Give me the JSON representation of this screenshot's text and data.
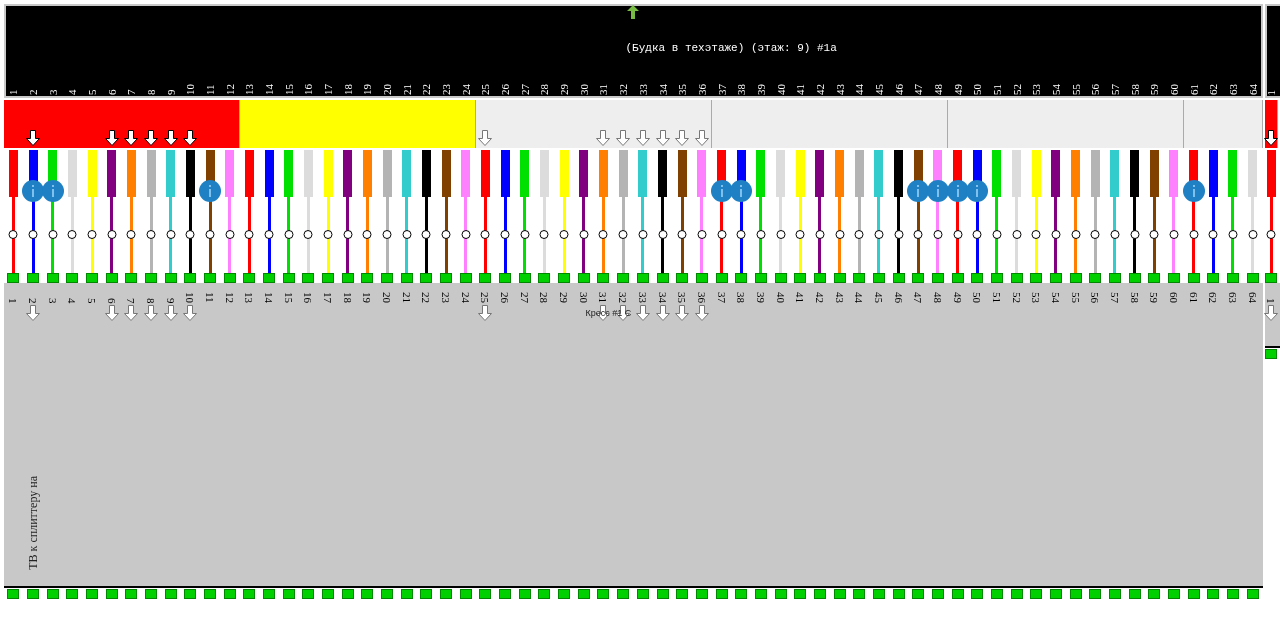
{
  "module": {
    "title": "(Будка в техэтаже) (этаж: 9) #1a",
    "caption": "Кросс #1 С",
    "side_text": "ТВ к сплиттеру на",
    "tubes": [
      {
        "color": "#ff0000",
        "fibers": [
          {
            "top_number": "1",
            "color": "#ff0000",
            "info": false,
            "bottom_number": "1",
            "bottom_arrow": false
          },
          {
            "top_number": "2",
            "color": "#0000ff",
            "band_arrow": {
              "kind": "solid"
            },
            "info": true,
            "bottom_number": "2",
            "bottom_arrow": true
          },
          {
            "top_number": "3",
            "color": "#00e000",
            "info": true,
            "bottom_number": "3",
            "bottom_arrow": false
          },
          {
            "top_number": "4",
            "color": "#dcdcdc",
            "info": false,
            "bottom_number": "4",
            "bottom_arrow": false
          },
          {
            "top_number": "5",
            "color": "#ffff00",
            "info": false,
            "bottom_number": "5",
            "bottom_arrow": false
          },
          {
            "top_number": "6",
            "color": "#800080",
            "band_arrow": {
              "kind": "solid"
            },
            "info": false,
            "bottom_number": "6",
            "bottom_arrow": true
          },
          {
            "top_number": "7",
            "color": "#ff8000",
            "band_arrow": {
              "kind": "solid"
            },
            "info": false,
            "bottom_number": "7",
            "bottom_arrow": true
          },
          {
            "top_number": "8",
            "color": "#b4b4b4",
            "band_arrow": {
              "kind": "solid"
            },
            "info": false,
            "bottom_number": "8",
            "bottom_arrow": true
          },
          {
            "top_number": "9",
            "color": "#33cccc",
            "band_arrow": {
              "kind": "solid"
            },
            "info": false,
            "bottom_number": "9",
            "bottom_arrow": true
          },
          {
            "top_number": "10",
            "color": "#000000",
            "band_arrow": {
              "kind": "solid"
            },
            "info": false,
            "bottom_number": "10",
            "bottom_arrow": true
          },
          {
            "top_number": "11",
            "color": "#804000",
            "info": true,
            "bottom_number": "11",
            "bottom_arrow": false
          },
          {
            "top_number": "12",
            "color": "#ff80ff",
            "info": false,
            "bottom_number": "12",
            "bottom_arrow": false
          }
        ]
      },
      {
        "color": "#ffff00",
        "fibers": [
          {
            "top_number": "13",
            "color": "#ff0000",
            "info": false,
            "bottom_number": "13",
            "bottom_arrow": false
          },
          {
            "top_number": "14",
            "color": "#0000ff",
            "info": false,
            "bottom_number": "14",
            "bottom_arrow": false
          },
          {
            "top_number": "15",
            "color": "#00e000",
            "info": false,
            "bottom_number": "15",
            "bottom_arrow": false
          },
          {
            "top_number": "16",
            "color": "#dcdcdc",
            "info": false,
            "bottom_number": "16",
            "bottom_arrow": false
          },
          {
            "top_number": "17",
            "color": "#ffff00",
            "info": false,
            "bottom_number": "17",
            "bottom_arrow": false
          },
          {
            "top_number": "18",
            "color": "#800080",
            "info": false,
            "bottom_number": "18",
            "bottom_arrow": false
          },
          {
            "top_number": "19",
            "color": "#ff8000",
            "info": false,
            "bottom_number": "19",
            "bottom_arrow": false
          },
          {
            "top_number": "20",
            "color": "#b4b4b4",
            "info": false,
            "bottom_number": "20",
            "bottom_arrow": false
          },
          {
            "top_number": "21",
            "color": "#33cccc",
            "info": false,
            "bottom_number": "21",
            "bottom_arrow": false
          },
          {
            "top_number": "22",
            "color": "#000000",
            "info": false,
            "bottom_number": "22",
            "bottom_arrow": false
          },
          {
            "top_number": "23",
            "color": "#804000",
            "info": false,
            "bottom_number": "23",
            "bottom_arrow": false
          },
          {
            "top_number": "24",
            "color": "#ff80ff",
            "info": false,
            "bottom_number": "24",
            "bottom_arrow": false
          }
        ]
      },
      {
        "color": "#eeeeee",
        "fibers": [
          {
            "top_number": "25",
            "color": "#ff0000",
            "band_arrow": {
              "kind": "outline"
            },
            "info": false,
            "bottom_number": "25",
            "bottom_arrow": true
          },
          {
            "top_number": "26",
            "color": "#0000ff",
            "info": false,
            "bottom_number": "26",
            "bottom_arrow": false
          },
          {
            "top_number": "27",
            "color": "#00e000",
            "info": false,
            "bottom_number": "27",
            "bottom_arrow": false
          },
          {
            "top_number": "28",
            "color": "#dcdcdc",
            "info": false,
            "bottom_number": "28",
            "bottom_arrow": false
          },
          {
            "top_number": "29",
            "color": "#ffff00",
            "info": false,
            "bottom_number": "29",
            "bottom_arrow": false
          },
          {
            "top_number": "30",
            "color": "#800080",
            "info": false,
            "bottom_number": "30",
            "bottom_arrow": false
          },
          {
            "top_number": "31",
            "color": "#ff8000",
            "band_arrow": {
              "kind": "outline"
            },
            "info": false,
            "bottom_number": "31",
            "bottom_arrow": true
          },
          {
            "top_number": "32",
            "color": "#b4b4b4",
            "band_arrow": {
              "kind": "outline"
            },
            "info": false,
            "bottom_number": "32",
            "bottom_arrow": true
          },
          {
            "top_number": "33",
            "color": "#33cccc",
            "band_arrow": {
              "kind": "outline"
            },
            "info": false,
            "bottom_number": "33",
            "bottom_arrow": true
          },
          {
            "top_number": "34",
            "color": "#000000",
            "band_arrow": {
              "kind": "outline"
            },
            "info": false,
            "bottom_number": "34",
            "bottom_arrow": true
          },
          {
            "top_number": "35",
            "color": "#804000",
            "band_arrow": {
              "kind": "outline"
            },
            "info": false,
            "bottom_number": "35",
            "bottom_arrow": true
          },
          {
            "top_number": "36",
            "color": "#ff80ff",
            "band_arrow": {
              "kind": "outline"
            },
            "info": false,
            "bottom_number": "36",
            "bottom_arrow": true
          }
        ]
      },
      {
        "color": "#eeeeee",
        "fibers": [
          {
            "top_number": "37",
            "color": "#ff0000",
            "info": true,
            "bottom_number": "37",
            "bottom_arrow": false
          },
          {
            "top_number": "38",
            "color": "#0000ff",
            "info": true,
            "bottom_number": "38",
            "bottom_arrow": false
          },
          {
            "top_number": "39",
            "color": "#00e000",
            "info": false,
            "bottom_number": "39",
            "bottom_arrow": false
          },
          {
            "top_number": "40",
            "color": "#dcdcdc",
            "info": false,
            "bottom_number": "40",
            "bottom_arrow": false
          },
          {
            "top_number": "41",
            "color": "#ffff00",
            "info": false,
            "bottom_number": "41",
            "bottom_arrow": false
          },
          {
            "top_number": "42",
            "color": "#800080",
            "info": false,
            "bottom_number": "42",
            "bottom_arrow": false
          },
          {
            "top_number": "43",
            "color": "#ff8000",
            "info": false,
            "bottom_number": "43",
            "bottom_arrow": false
          },
          {
            "top_number": "44",
            "color": "#b4b4b4",
            "info": false,
            "bottom_number": "44",
            "bottom_arrow": false
          },
          {
            "top_number": "45",
            "color": "#33cccc",
            "info": false,
            "bottom_number": "45",
            "bottom_arrow": false
          },
          {
            "top_number": "46",
            "color": "#000000",
            "info": false,
            "bottom_number": "46",
            "bottom_arrow": false
          },
          {
            "top_number": "47",
            "color": "#804000",
            "info": true,
            "bottom_number": "47",
            "bottom_arrow": false
          },
          {
            "top_number": "48",
            "color": "#ff80ff",
            "info": true,
            "bottom_number": "48",
            "bottom_arrow": false
          }
        ]
      },
      {
        "color": "#eeeeee",
        "fibers": [
          {
            "top_number": "49",
            "color": "#ff0000",
            "info": true,
            "bottom_number": "49",
            "bottom_arrow": false
          },
          {
            "top_number": "50",
            "color": "#0000ff",
            "info": true,
            "bottom_number": "50",
            "bottom_arrow": false
          },
          {
            "top_number": "51",
            "color": "#00e000",
            "info": false,
            "bottom_number": "51",
            "bottom_arrow": false
          },
          {
            "top_number": "52",
            "color": "#dcdcdc",
            "info": false,
            "bottom_number": "52",
            "bottom_arrow": false
          },
          {
            "top_number": "53",
            "color": "#ffff00",
            "info": false,
            "bottom_number": "53",
            "bottom_arrow": false
          },
          {
            "top_number": "54",
            "color": "#800080",
            "info": false,
            "bottom_number": "54",
            "bottom_arrow": false
          },
          {
            "top_number": "55",
            "color": "#ff8000",
            "info": false,
            "bottom_number": "55",
            "bottom_arrow": false
          },
          {
            "top_number": "56",
            "color": "#b4b4b4",
            "info": false,
            "bottom_number": "56",
            "bottom_arrow": false
          },
          {
            "top_number": "57",
            "color": "#33cccc",
            "info": false,
            "bottom_number": "57",
            "bottom_arrow": false
          },
          {
            "top_number": "58",
            "color": "#000000",
            "info": false,
            "bottom_number": "58",
            "bottom_arrow": false
          },
          {
            "top_number": "59",
            "color": "#804000",
            "info": false,
            "bottom_number": "59",
            "bottom_arrow": false
          },
          {
            "top_number": "60",
            "color": "#ff80ff",
            "info": false,
            "bottom_number": "60",
            "bottom_arrow": false
          }
        ]
      },
      {
        "color": "#eeeeee",
        "fibers": [
          {
            "top_number": "61",
            "color": "#ff0000",
            "info": true,
            "bottom_number": "61",
            "bottom_arrow": false
          },
          {
            "top_number": "62",
            "color": "#0000ff",
            "info": false,
            "bottom_number": "62",
            "bottom_arrow": false
          },
          {
            "top_number": "63",
            "color": "#00e000",
            "info": false,
            "bottom_number": "63",
            "bottom_arrow": false
          },
          {
            "top_number": "64",
            "color": "#dcdcdc",
            "info": false,
            "bottom_number": "64",
            "bottom_arrow": false
          }
        ]
      }
    ]
  },
  "next_module": {
    "tubes": [
      {
        "color": "#ff0000",
        "fibers": [
          {
            "top_number": "1",
            "color": "#ff0000",
            "band_arrow": {
              "kind": "solid"
            },
            "info": false,
            "bottom_number": "1",
            "bottom_arrow": true
          }
        ]
      }
    ]
  }
}
